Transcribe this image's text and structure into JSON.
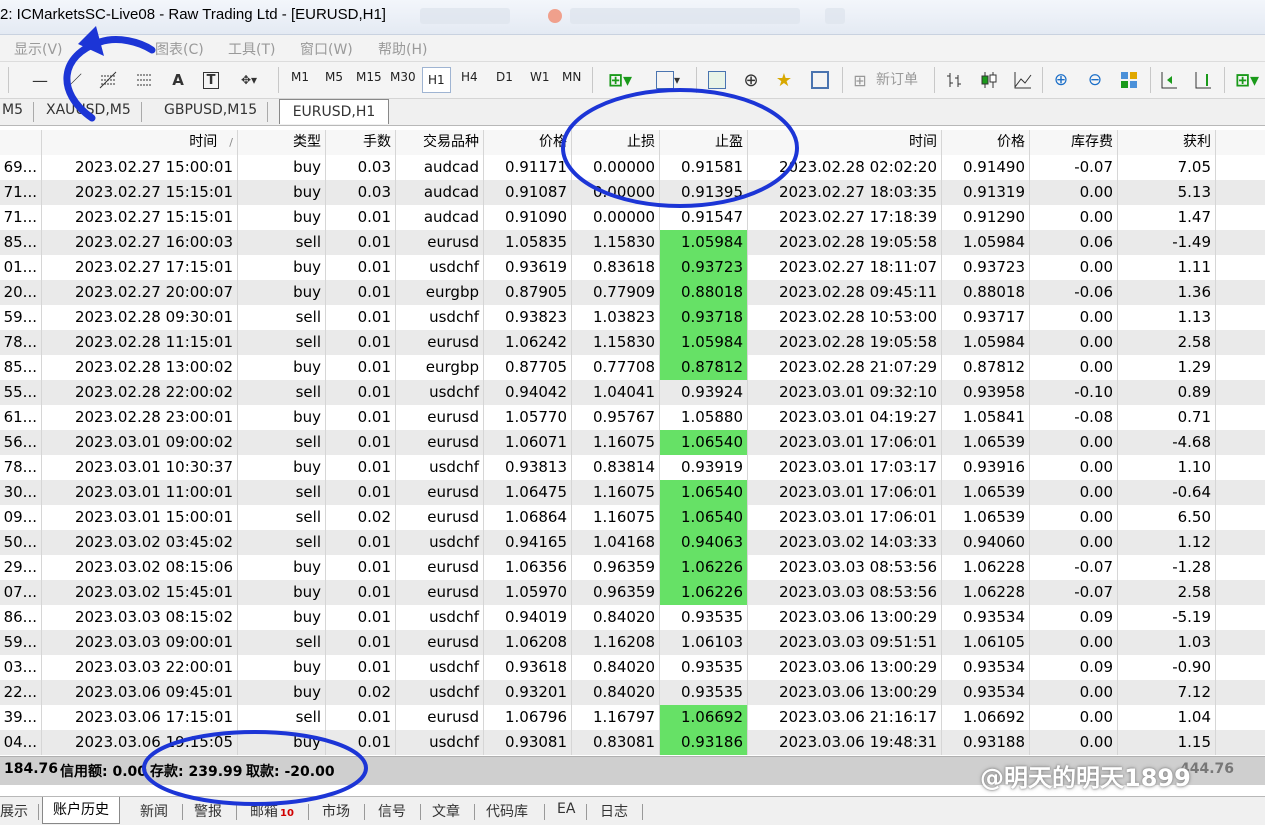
{
  "window": {
    "title": "2: ICMarketsSC-Live08 - Raw Trading Ltd - [EURUSD,H1]"
  },
  "menu": [
    "显示(V)",
    "图表(C)",
    "工具(T)",
    "窗口(W)",
    "帮助(H)"
  ],
  "toolbar": {
    "timeframes": [
      "M1",
      "M5",
      "M15",
      "M30",
      "H1",
      "H4",
      "D1",
      "W1",
      "MN"
    ],
    "active_timeframe": "H1",
    "new_order_label": "新订单"
  },
  "chart_tabs": [
    "M5",
    "XAUUSD,M5",
    "GBPUSD,M15",
    "EURUSD,H1"
  ],
  "active_chart_tab": "EURUSD,H1",
  "columns": [
    "时间",
    "类型",
    "手数",
    "交易品种",
    "价格",
    "止损",
    "止盈",
    "时间",
    "价格",
    "库存费",
    "获利"
  ],
  "sort_indicator": "/",
  "rows": [
    [
      "69...",
      "2023.02.27 15:00:01",
      "buy",
      "0.03",
      "audcad",
      "0.91171",
      "0.00000",
      "0.91581",
      "2023.02.28 02:02:20",
      "0.91490",
      "-0.07",
      "7.05",
      false
    ],
    [
      "71...",
      "2023.02.27 15:15:01",
      "buy",
      "0.03",
      "audcad",
      "0.91087",
      "0.00000",
      "0.91395",
      "2023.02.27 18:03:35",
      "0.91319",
      "0.00",
      "5.13",
      false
    ],
    [
      "71...",
      "2023.02.27 15:15:01",
      "buy",
      "0.01",
      "audcad",
      "0.91090",
      "0.00000",
      "0.91547",
      "2023.02.27 17:18:39",
      "0.91290",
      "0.00",
      "1.47",
      false
    ],
    [
      "85...",
      "2023.02.27 16:00:03",
      "sell",
      "0.01",
      "eurusd",
      "1.05835",
      "1.15830",
      "1.05984",
      "2023.02.28 19:05:58",
      "1.05984",
      "0.06",
      "-1.49",
      true
    ],
    [
      "01...",
      "2023.02.27 17:15:01",
      "buy",
      "0.01",
      "usdchf",
      "0.93619",
      "0.83618",
      "0.93723",
      "2023.02.27 18:11:07",
      "0.93723",
      "0.00",
      "1.11",
      true
    ],
    [
      "20...",
      "2023.02.27 20:00:07",
      "buy",
      "0.01",
      "eurgbp",
      "0.87905",
      "0.77909",
      "0.88018",
      "2023.02.28 09:45:11",
      "0.88018",
      "-0.06",
      "1.36",
      true
    ],
    [
      "59...",
      "2023.02.28 09:30:01",
      "sell",
      "0.01",
      "usdchf",
      "0.93823",
      "1.03823",
      "0.93718",
      "2023.02.28 10:53:00",
      "0.93717",
      "0.00",
      "1.13",
      true
    ],
    [
      "78...",
      "2023.02.28 11:15:01",
      "sell",
      "0.01",
      "eurusd",
      "1.06242",
      "1.15830",
      "1.05984",
      "2023.02.28 19:05:58",
      "1.05984",
      "0.00",
      "2.58",
      true
    ],
    [
      "85...",
      "2023.02.28 13:00:02",
      "buy",
      "0.01",
      "eurgbp",
      "0.87705",
      "0.77708",
      "0.87812",
      "2023.02.28 21:07:29",
      "0.87812",
      "0.00",
      "1.29",
      true
    ],
    [
      "55...",
      "2023.02.28 22:00:02",
      "sell",
      "0.01",
      "usdchf",
      "0.94042",
      "1.04041",
      "0.93924",
      "2023.03.01 09:32:10",
      "0.93958",
      "-0.10",
      "0.89",
      false
    ],
    [
      "61...",
      "2023.02.28 23:00:01",
      "buy",
      "0.01",
      "eurusd",
      "1.05770",
      "0.95767",
      "1.05880",
      "2023.03.01 04:19:27",
      "1.05841",
      "-0.08",
      "0.71",
      false
    ],
    [
      "56...",
      "2023.03.01 09:00:02",
      "sell",
      "0.01",
      "eurusd",
      "1.06071",
      "1.16075",
      "1.06540",
      "2023.03.01 17:06:01",
      "1.06539",
      "0.00",
      "-4.68",
      true
    ],
    [
      "78...",
      "2023.03.01 10:30:37",
      "buy",
      "0.01",
      "usdchf",
      "0.93813",
      "0.83814",
      "0.93919",
      "2023.03.01 17:03:17",
      "0.93916",
      "0.00",
      "1.10",
      false
    ],
    [
      "30...",
      "2023.03.01 11:00:01",
      "sell",
      "0.01",
      "eurusd",
      "1.06475",
      "1.16075",
      "1.06540",
      "2023.03.01 17:06:01",
      "1.06539",
      "0.00",
      "-0.64",
      true
    ],
    [
      "09...",
      "2023.03.01 15:00:01",
      "sell",
      "0.02",
      "eurusd",
      "1.06864",
      "1.16075",
      "1.06540",
      "2023.03.01 17:06:01",
      "1.06539",
      "0.00",
      "6.50",
      true
    ],
    [
      "50...",
      "2023.03.02 03:45:02",
      "sell",
      "0.01",
      "usdchf",
      "0.94165",
      "1.04168",
      "0.94063",
      "2023.03.02 14:03:33",
      "0.94060",
      "0.00",
      "1.12",
      true
    ],
    [
      "29...",
      "2023.03.02 08:15:06",
      "buy",
      "0.01",
      "eurusd",
      "1.06356",
      "0.96359",
      "1.06226",
      "2023.03.03 08:53:56",
      "1.06228",
      "-0.07",
      "-1.28",
      true
    ],
    [
      "07...",
      "2023.03.02 15:45:01",
      "buy",
      "0.01",
      "eurusd",
      "1.05970",
      "0.96359",
      "1.06226",
      "2023.03.03 08:53:56",
      "1.06228",
      "-0.07",
      "2.58",
      true
    ],
    [
      "86...",
      "2023.03.03 08:15:02",
      "buy",
      "0.01",
      "usdchf",
      "0.94019",
      "0.84020",
      "0.93535",
      "2023.03.06 13:00:29",
      "0.93534",
      "0.09",
      "-5.19",
      false
    ],
    [
      "59...",
      "2023.03.03 09:00:01",
      "sell",
      "0.01",
      "eurusd",
      "1.06208",
      "1.16208",
      "1.06103",
      "2023.03.03 09:51:51",
      "1.06105",
      "0.00",
      "1.03",
      false
    ],
    [
      "03...",
      "2023.03.03 22:00:01",
      "buy",
      "0.01",
      "usdchf",
      "0.93618",
      "0.84020",
      "0.93535",
      "2023.03.06 13:00:29",
      "0.93534",
      "0.09",
      "-0.90",
      false
    ],
    [
      "22...",
      "2023.03.06 09:45:01",
      "buy",
      "0.02",
      "usdchf",
      "0.93201",
      "0.84020",
      "0.93535",
      "2023.03.06 13:00:29",
      "0.93534",
      "0.00",
      "7.12",
      false
    ],
    [
      "39...",
      "2023.03.06 17:15:01",
      "sell",
      "0.01",
      "eurusd",
      "1.06796",
      "1.16797",
      "1.06692",
      "2023.03.06 21:16:17",
      "1.06692",
      "0.00",
      "1.04",
      true
    ],
    [
      "04...",
      "2023.03.06 19:15:05",
      "buy",
      "0.01",
      "usdchf",
      "0.93081",
      "0.83081",
      "0.93186",
      "2023.03.06 19:48:31",
      "0.93188",
      "0.00",
      "1.15",
      true
    ]
  ],
  "summary": {
    "profit": "184.76",
    "credit": "信用额: 0.00",
    "deposit": "存款: 239.99",
    "withdrawal": "取款: -20.00",
    "total_partial": "444.76"
  },
  "watermark": "@明天的明天1899",
  "bottom_tabs": [
    "展示",
    "账户历史",
    "新闻",
    "警报",
    "邮箱",
    "市场",
    "信号",
    "文章",
    "代码库",
    "EA",
    "日志"
  ],
  "active_bottom_tab": "账户历史",
  "mail_badge": "10",
  "colors": {
    "take_profit_hit": "#66e166",
    "annotation": "#1c35d6"
  }
}
